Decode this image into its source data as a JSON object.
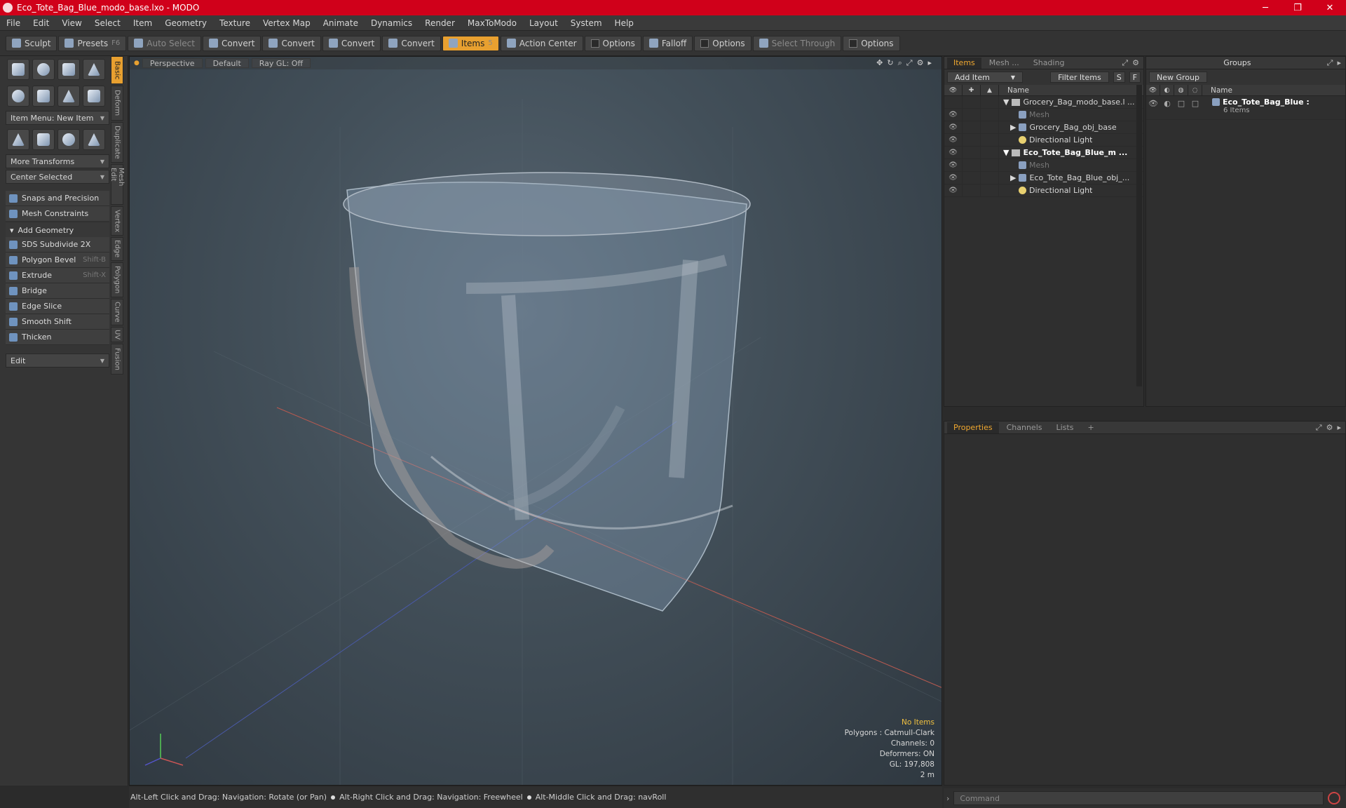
{
  "title": "Eco_Tote_Bag_Blue_modo_base.lxo - MODO",
  "window_controls": {
    "minimize": "─",
    "maximize": "❐",
    "close": "✕"
  },
  "menu": [
    "File",
    "Edit",
    "View",
    "Select",
    "Item",
    "Geometry",
    "Texture",
    "Vertex Map",
    "Animate",
    "Dynamics",
    "Render",
    "MaxToModo",
    "Layout",
    "System",
    "Help"
  ],
  "toolbar": {
    "sculpt": "Sculpt",
    "presets": "Presets",
    "presets_key": "F6",
    "auto_select": "Auto Select",
    "convert1": "Convert",
    "convert2": "Convert",
    "convert3": "Convert",
    "convert4": "Convert",
    "items": "Items",
    "items_key": "5",
    "action_center": "Action Center",
    "options1": "Options",
    "falloff": "Falloff",
    "options2": "Options",
    "select_through": "Select Through",
    "options3": "Options"
  },
  "left": {
    "item_menu": "Item Menu: New Item",
    "more_transforms": "More Transforms",
    "center_selected": "Center Selected",
    "snaps": "Snaps and Precision",
    "mesh_constraints": "Mesh Constraints",
    "add_geometry": "Add Geometry",
    "tools": [
      {
        "label": "SDS Subdivide 2X",
        "key": ""
      },
      {
        "label": "Polygon Bevel",
        "key": "Shift-B"
      },
      {
        "label": "Extrude",
        "key": "Shift-X"
      },
      {
        "label": "Bridge",
        "key": ""
      },
      {
        "label": "Edge Slice",
        "key": ""
      },
      {
        "label": "Smooth Shift",
        "key": ""
      },
      {
        "label": "Thicken",
        "key": ""
      }
    ],
    "edit_dd": "Edit",
    "vtabs": [
      "Basic",
      "Deform",
      "Duplicate",
      "Mesh Edit",
      "Vertex",
      "Edge",
      "Polygon",
      "Curve",
      "UV",
      "Fusion"
    ]
  },
  "viewport": {
    "perspective": "Perspective",
    "default": "Default",
    "raygl": "Ray GL: Off",
    "info": {
      "no_items": "No Items",
      "polygons": "Polygons : Catmull-Clark",
      "channels": "Channels: 0",
      "deformers": "Deformers: ON",
      "gl": "GL: 197,808",
      "scale": "2 m"
    }
  },
  "status": {
    "s1": "Alt-Left Click and Drag: Navigation: Rotate (or Pan)",
    "s2": "Alt-Right Click and Drag: Navigation: Freewheel",
    "s3": "Alt-Middle Click and Drag: navRoll"
  },
  "items_panel": {
    "tabs": [
      "Items",
      "Mesh ...",
      "Shading"
    ],
    "add_item": "Add Item",
    "filter_items": "Filter Items",
    "s": "S",
    "f": "F",
    "name_col": "Name",
    "rows": [
      {
        "name": "Grocery_Bag_modo_base.l ...",
        "type": "scene",
        "level": 0,
        "style": ""
      },
      {
        "name": "Mesh",
        "type": "mesh",
        "level": 2,
        "style": "dim"
      },
      {
        "name": "Grocery_Bag_obj_base",
        "type": "mesh",
        "level": 1,
        "style": ""
      },
      {
        "name": "Directional Light",
        "type": "light",
        "level": 1,
        "style": ""
      },
      {
        "name": "Eco_Tote_Bag_Blue_m ...",
        "type": "scene",
        "level": 0,
        "style": "bold"
      },
      {
        "name": "Mesh",
        "type": "mesh",
        "level": 2,
        "style": "dim"
      },
      {
        "name": "Eco_Tote_Bag_Blue_obj_...",
        "type": "mesh",
        "level": 1,
        "style": ""
      },
      {
        "name": "Directional Light",
        "type": "light",
        "level": 1,
        "style": ""
      }
    ]
  },
  "groups_panel": {
    "title": "Groups",
    "new_group": "New Group",
    "name_col": "Name",
    "group_name": "Eco_Tote_Bag_Blue :",
    "group_count": "6 Items"
  },
  "props_panel": {
    "tabs": [
      "Properties",
      "Channels",
      "Lists"
    ],
    "plus": "+"
  },
  "command": {
    "placeholder": "Command"
  }
}
